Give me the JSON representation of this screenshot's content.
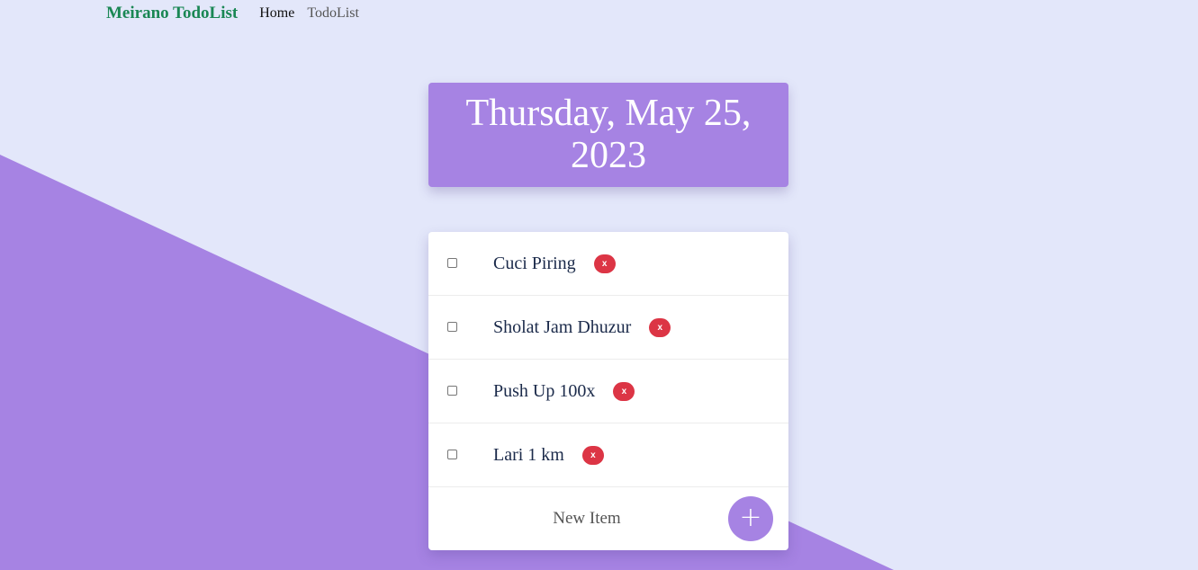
{
  "nav": {
    "brand": "Meirano TodoList",
    "links": [
      {
        "label": "Home"
      },
      {
        "label": "TodoList"
      }
    ]
  },
  "header": {
    "date": "Thursday, May 25, 2023"
  },
  "todos": {
    "items": [
      {
        "label": "Cuci Piring",
        "checked": false,
        "delete_label": "x"
      },
      {
        "label": "Sholat Jam Dhuzur",
        "checked": false,
        "delete_label": "x"
      },
      {
        "label": "Push Up 100x",
        "checked": false,
        "delete_label": "x"
      },
      {
        "label": "Lari 1 km",
        "checked": false,
        "delete_label": "x"
      }
    ],
    "new_item_placeholder": "New Item",
    "add_label": "+"
  },
  "colors": {
    "background": "#e3e7fa",
    "accent": "#a683e3",
    "brand": "#1a8754",
    "delete": "#dc3545"
  }
}
